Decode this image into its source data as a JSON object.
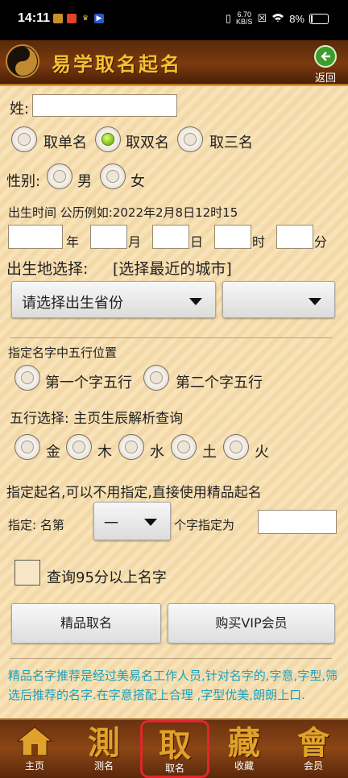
{
  "status": {
    "time": "14:11",
    "net_speed": "6.70",
    "net_unit": "KB/S",
    "battery": "8%"
  },
  "header": {
    "title": "易学取名起名",
    "back_label": "返回"
  },
  "form": {
    "surname_label": "姓:",
    "surname_value": "",
    "name_type": {
      "options": [
        "取单名",
        "取双名",
        "取三名"
      ],
      "selected": "取双名"
    },
    "gender": {
      "label": "性别:",
      "options": [
        "男",
        "女"
      ]
    },
    "birth_time": {
      "label": "出生时间 公历例如:2022年2月8日12时15",
      "units": [
        "年",
        "月",
        "日",
        "时",
        "分"
      ],
      "values": [
        "",
        "",
        "",
        "",
        ""
      ]
    },
    "birthplace": {
      "label": "出生地选择:",
      "hint": "[选择最近的城市]",
      "province_placeholder": "请选择出生省份",
      "city_value": ""
    },
    "wuxing_position": {
      "label": "指定名字中五行位置",
      "options": [
        "第一个字五行",
        "第二个字五行"
      ]
    },
    "wuxing_select": {
      "label": "五行选择: 主页生辰解析查询",
      "options": [
        "金",
        "木",
        "水",
        "土",
        "火"
      ]
    },
    "specify": {
      "title": "指定起名,可以不用指定,直接使用精品起名",
      "prefix": "指定: 名第",
      "ordinal_value": "一",
      "suffix": "个字指定为",
      "char_value": ""
    },
    "high_score_label": "查询95分以上名字",
    "buttons": {
      "premium": "精品取名",
      "vip": "购买VIP会员"
    },
    "note": "精品名字推荐是经过美易名工作人员,针对名字的,字意,字型,筛选后推荐的名字.在字意搭配上合理 ,字型优美,朗朗上口."
  },
  "bottom_nav": [
    {
      "glyph": "",
      "label": "主页",
      "icon": "home-icon"
    },
    {
      "glyph": "測",
      "label": "测名",
      "icon": "test-name-icon"
    },
    {
      "glyph": "取",
      "label": "取名",
      "icon": "pick-name-icon",
      "active": true
    },
    {
      "glyph": "藏",
      "label": "收藏",
      "icon": "favorites-icon"
    },
    {
      "glyph": "會",
      "label": "会员",
      "icon": "member-icon"
    }
  ],
  "colors": {
    "accent_gold": "#e0a22a",
    "note_text": "#1aa0bd",
    "active_outline": "#e0262c",
    "radio_selected": "#7ec10e"
  }
}
